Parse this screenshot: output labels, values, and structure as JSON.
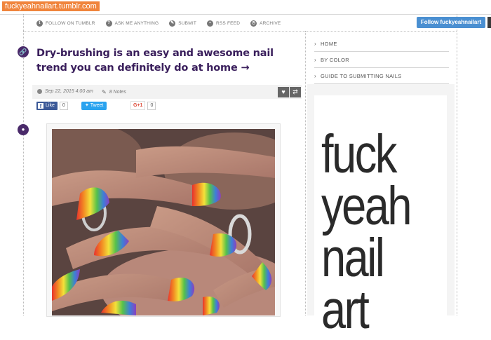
{
  "browser": {
    "url": "fuckyeahnailart.tumblr.com"
  },
  "topnav": {
    "items": [
      {
        "label": "FOLLOW ON TUMBLR",
        "icon": "tumblr-icon"
      },
      {
        "label": "ASK ME ANYTHING",
        "icon": "question-icon"
      },
      {
        "label": "SUBMIT",
        "icon": "pencil-icon"
      },
      {
        "label": "RSS FEED",
        "icon": "rss-icon"
      },
      {
        "label": "ARCHIVE",
        "icon": "clock-icon"
      }
    ],
    "follow_button": "Follow fuckyeahnailart"
  },
  "post": {
    "title": "Dry-brushing is an easy and awesome nail trend you can definitely do at home →",
    "date": "Sep 22, 2015 4:00 am",
    "notes": "8 Notes",
    "share": {
      "fb_label": "Like",
      "fb_count": "0",
      "tweet_label": "Tweet",
      "gplus_label": "G+1",
      "gplus_count": "0"
    }
  },
  "sidebar": {
    "links": [
      "HOME",
      "BY COLOR",
      "GUIDE TO SUBMITTING NAILS"
    ],
    "logo_lines": [
      "fuck",
      "yeah",
      "nail",
      "art"
    ]
  },
  "colors": {
    "title": "#3a1f5c",
    "follow_button": "#4a8fd1",
    "url_highlight": "#f0843c",
    "facebook": "#3b5998",
    "twitter": "#2aa3ef"
  }
}
